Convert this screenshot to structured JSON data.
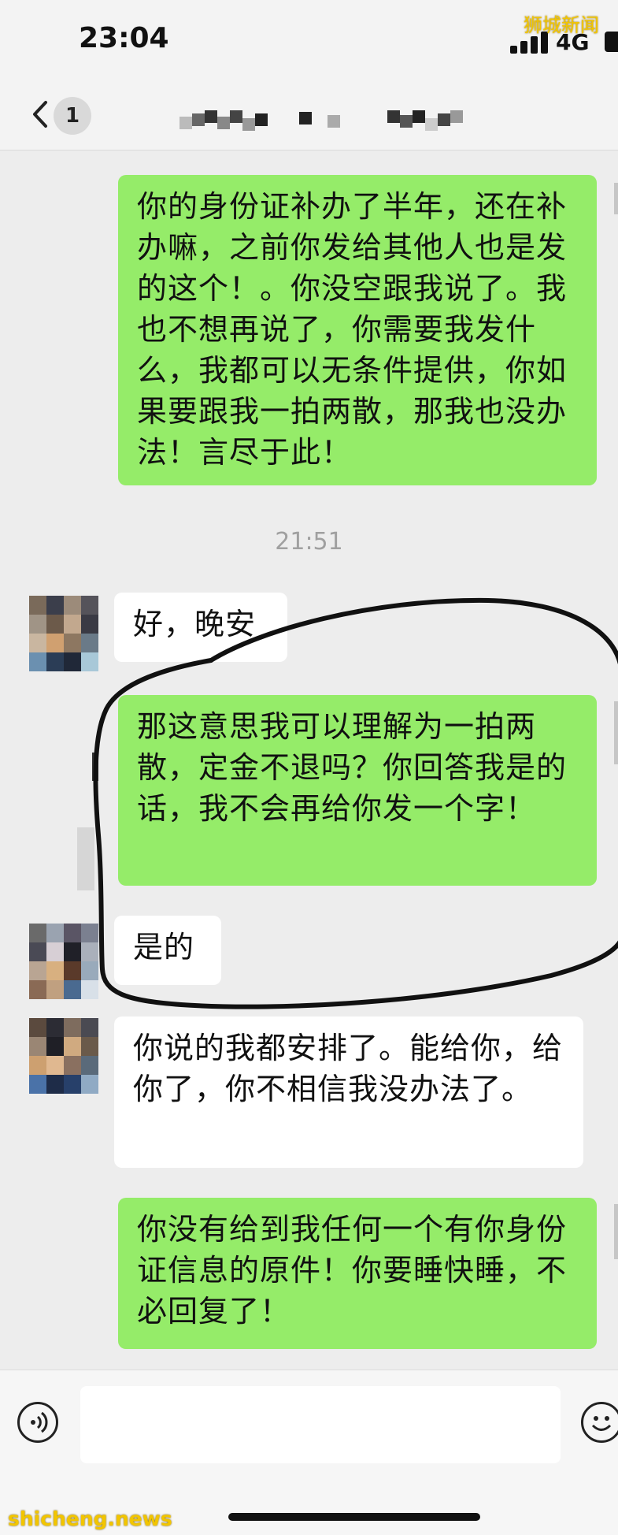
{
  "status": {
    "time": "23:04",
    "network": "4G"
  },
  "watermark": {
    "top": "狮城新闻",
    "bottom": "shicheng.news"
  },
  "nav": {
    "back_badge": "1"
  },
  "messages": [
    {
      "side": "me",
      "text": "你的身份证补办了半年，还在补办嘛，之前你发给其他人也是发的这个！。你没空跟我说了。我也不想再说了，你需要我发什么，我都可以无条件提供，你如果要跟我一拍两散，那我也没办法！言尽于此！"
    },
    {
      "side": "timestamp",
      "text": "21:51"
    },
    {
      "side": "them",
      "text": "好，晚安"
    },
    {
      "side": "me",
      "text": "那这意思我可以理解为一拍两散，定金不退吗？你回答我是的话，我不会再给你发一个字！"
    },
    {
      "side": "them",
      "text": "是的"
    },
    {
      "side": "them",
      "text": "你说的我都安排了。能给你，给你了，你不相信我没办法了。"
    },
    {
      "side": "me",
      "text": "你没有给到我任何一个有你身份证信息的原件！你要睡快睡，不必回复了！"
    }
  ],
  "colors": {
    "me_bubble": "#95ec69",
    "them_bubble": "#ffffff",
    "background": "#ededed",
    "annotation": "#111111"
  },
  "icons": {
    "back": "chevron-left-icon",
    "voice": "voice-icon",
    "emoji": "emoji-icon"
  }
}
